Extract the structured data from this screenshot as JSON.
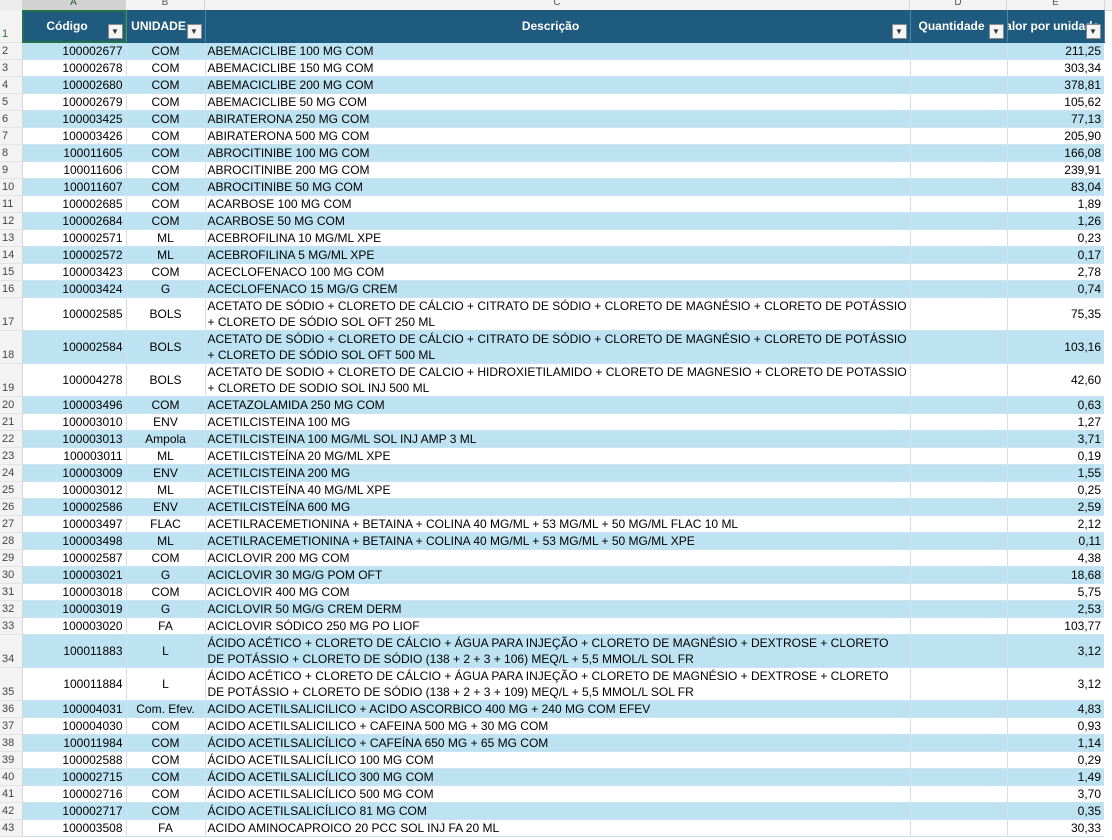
{
  "columns": [
    "A",
    "B",
    "C",
    "D",
    "E"
  ],
  "headers": {
    "codigo": "Código",
    "unidade": "UNIDADE",
    "descricao": "Descrição",
    "quantidade": "Quantidade",
    "valor": "Valor por unidade"
  },
  "rows": [
    {
      "n": "2",
      "codigo": "100002677",
      "unidade": "COM",
      "descricao": "ABEMACICLIBE 100 MG COM",
      "valor": "211,25"
    },
    {
      "n": "3",
      "codigo": "100002678",
      "unidade": "COM",
      "descricao": "ABEMACICLIBE 150 MG COM",
      "valor": "303,34"
    },
    {
      "n": "4",
      "codigo": "100002680",
      "unidade": "COM",
      "descricao": "ABEMACICLIBE 200 MG COM",
      "valor": "378,81"
    },
    {
      "n": "5",
      "codigo": "100002679",
      "unidade": "COM",
      "descricao": "ABEMACICLIBE 50 MG COM",
      "valor": "105,62"
    },
    {
      "n": "6",
      "codigo": "100003425",
      "unidade": "COM",
      "descricao": "ABIRATERONA 250 MG COM",
      "valor": "77,13"
    },
    {
      "n": "7",
      "codigo": "100003426",
      "unidade": "COM",
      "descricao": "ABIRATERONA 500 MG COM",
      "valor": "205,90"
    },
    {
      "n": "8",
      "codigo": "100011605",
      "unidade": "COM",
      "descricao": "ABROCITINIBE 100 MG COM",
      "valor": "166,08"
    },
    {
      "n": "9",
      "codigo": "100011606",
      "unidade": "COM",
      "descricao": "ABROCITINIBE 200 MG COM",
      "valor": "239,91"
    },
    {
      "n": "10",
      "codigo": "100011607",
      "unidade": "COM",
      "descricao": "ABROCITINIBE 50 MG COM",
      "valor": "83,04"
    },
    {
      "n": "11",
      "codigo": "100002685",
      "unidade": "COM",
      "descricao": "ACARBOSE 100 MG COM",
      "valor": "1,89"
    },
    {
      "n": "12",
      "codigo": "100002684",
      "unidade": "COM",
      "descricao": "ACARBOSE 50 MG COM",
      "valor": "1,26"
    },
    {
      "n": "13",
      "codigo": "100002571",
      "unidade": "ML",
      "descricao": "ACEBROFILINA 10 MG/ML XPE",
      "valor": "0,23"
    },
    {
      "n": "14",
      "codigo": "100002572",
      "unidade": "ML",
      "descricao": "ACEBROFILINA 5 MG/ML XPE",
      "valor": "0,17"
    },
    {
      "n": "15",
      "codigo": "100003423",
      "unidade": "COM",
      "descricao": "ACECLOFENACO 100 MG COM",
      "valor": "2,78"
    },
    {
      "n": "16",
      "codigo": "100003424",
      "unidade": "G",
      "descricao": "ACECLOFENACO 15 MG/G CREM",
      "valor": "0,74"
    },
    {
      "n": "17",
      "codigo": "100002585",
      "unidade": "BOLS",
      "descricao": "ACETATO DE SÓDIO + CLORETO DE CÁLCIO + CITRATO DE SÓDIO + CLORETO DE MAGNÉSIO + CLORETO DE POTÁSSIO + CLORETO DE SÓDIO SOL OFT 250 ML",
      "valor": "75,35",
      "tall": true
    },
    {
      "n": "18",
      "codigo": "100002584",
      "unidade": "BOLS",
      "descricao": "ACETATO DE SÓDIO + CLORETO DE CÁLCIO + CITRATO DE SÓDIO + CLORETO DE MAGNÉSIO + CLORETO DE POTÁSSIO + CLORETO DE SÓDIO SOL OFT 500 ML",
      "valor": "103,16",
      "tall": true
    },
    {
      "n": "19",
      "codigo": "100004278",
      "unidade": "BOLS",
      "descricao": "ACETATO DE SODIO + CLORETO DE CALCIO + HIDROXIETILAMIDO + CLORETO DE MAGNESIO + CLORETO DE POTASSIO + CLORETO DE SODIO SOL INJ 500 ML",
      "valor": "42,60",
      "tall": true
    },
    {
      "n": "20",
      "codigo": "100003496",
      "unidade": "COM",
      "descricao": "ACETAZOLAMIDA 250 MG COM",
      "valor": "0,63"
    },
    {
      "n": "21",
      "codigo": "100003010",
      "unidade": "ENV",
      "descricao": "ACETILCISTEINA 100 MG",
      "valor": "1,27"
    },
    {
      "n": "22",
      "codigo": "100003013",
      "unidade": "Ampola",
      "descricao": "ACETILCISTEINA 100 MG/ML SOL INJ AMP 3 ML",
      "valor": "3,71"
    },
    {
      "n": "23",
      "codigo": "100003011",
      "unidade": "ML",
      "descricao": "ACETILCISTEÍNA 20 MG/ML XPE",
      "valor": "0,19"
    },
    {
      "n": "24",
      "codigo": "100003009",
      "unidade": "ENV",
      "descricao": "ACETILCISTEINA 200 MG",
      "valor": "1,55"
    },
    {
      "n": "25",
      "codigo": "100003012",
      "unidade": "ML",
      "descricao": "ACETILCISTEÍNA 40 MG/ML XPE",
      "valor": "0,25"
    },
    {
      "n": "26",
      "codigo": "100002586",
      "unidade": "ENV",
      "descricao": "ACETILCISTEÍNA 600 MG",
      "valor": "2,59"
    },
    {
      "n": "27",
      "codigo": "100003497",
      "unidade": "FLAC",
      "descricao": "ACETILRACEMETIONINA + BETAINA + COLINA 40 MG/ML + 53 MG/ML + 50 MG/ML FLAC 10 ML",
      "valor": "2,12"
    },
    {
      "n": "28",
      "codigo": "100003498",
      "unidade": "ML",
      "descricao": "ACETILRACEMETIONINA + BETAINA + COLINA 40 MG/ML + 53 MG/ML + 50 MG/ML XPE",
      "valor": "0,11"
    },
    {
      "n": "29",
      "codigo": "100002587",
      "unidade": "COM",
      "descricao": "ACICLOVIR 200 MG COM",
      "valor": "4,38"
    },
    {
      "n": "30",
      "codigo": "100003021",
      "unidade": "G",
      "descricao": "ACICLOVIR 30 MG/G POM OFT",
      "valor": "18,68"
    },
    {
      "n": "31",
      "codigo": "100003018",
      "unidade": "COM",
      "descricao": "ACICLOVIR 400 MG COM",
      "valor": "5,75"
    },
    {
      "n": "32",
      "codigo": "100003019",
      "unidade": "G",
      "descricao": "ACICLOVIR 50 MG/G CREM DERM",
      "valor": "2,53"
    },
    {
      "n": "33",
      "codigo": "100003020",
      "unidade": "FA",
      "descricao": "ACICLOVIR SÓDICO 250 MG PO LIOF",
      "valor": "103,77"
    },
    {
      "n": "34",
      "codigo": "100011883",
      "unidade": "L",
      "descricao": "ÁCIDO ACÉTICO + CLORETO DE CÁLCIO + ÁGUA PARA INJEÇÃO + CLORETO DE MAGNÉSIO + DEXTROSE + CLORETO DE POTÁSSIO + CLORETO DE SÓDIO (138 + 2 + 3 + 106) MEQ/L + 5,5 MMOL/L SOL FR",
      "valor": "3,12",
      "tall": true
    },
    {
      "n": "35",
      "codigo": "100011884",
      "unidade": "L",
      "descricao": "ÁCIDO ACÉTICO + CLORETO DE CÁLCIO + ÁGUA PARA INJEÇÃO + CLORETO DE MAGNÉSIO + DEXTROSE + CLORETO DE POTÁSSIO + CLORETO DE SÓDIO (138 + 2 + 3 + 109) MEQ/L + 5,5 MMOL/L SOL FR",
      "valor": "3,12",
      "tall": true
    },
    {
      "n": "36",
      "codigo": "100004031",
      "unidade": "Com. Efev.",
      "descricao": "ACIDO ACETILSALICILICO + ACIDO ASCORBICO 400 MG + 240 MG COM EFEV",
      "valor": "4,83"
    },
    {
      "n": "37",
      "codigo": "100004030",
      "unidade": "COM",
      "descricao": "ACIDO ACETILSALICILICO + CAFEINA 500 MG + 30 MG COM",
      "valor": "0,93"
    },
    {
      "n": "38",
      "codigo": "100011984",
      "unidade": "COM",
      "descricao": "ÁCIDO ACETILSALICÍLICO + CAFEÍNA 650 MG + 65 MG COM",
      "valor": "1,14"
    },
    {
      "n": "39",
      "codigo": "100002588",
      "unidade": "COM",
      "descricao": "ÁCIDO ACETILSALICÍLICO 100 MG COM",
      "valor": "0,29"
    },
    {
      "n": "40",
      "codigo": "100002715",
      "unidade": "COM",
      "descricao": "ÁCIDO ACETILSALICÍLICO 300 MG COM",
      "valor": "1,49"
    },
    {
      "n": "41",
      "codigo": "100002716",
      "unidade": "COM",
      "descricao": "ÁCIDO ACETILSALICÍLICO 500 MG COM",
      "valor": "3,70"
    },
    {
      "n": "42",
      "codigo": "100002717",
      "unidade": "COM",
      "descricao": "ÁCIDO ACETILSALICÍLICO 81 MG COM",
      "valor": "0,35"
    },
    {
      "n": "43",
      "codigo": "100003508",
      "unidade": "FA",
      "descricao": "ACIDO AMINOCAPROICO 20 PCC SOL INJ FA 20 ML",
      "valor": "30,33"
    }
  ],
  "header_row_number": "1",
  "filter_icon": "dropdown-arrow-icon",
  "colors": {
    "header_bg": "#1f5b7e",
    "alt_row": "#bde3f2",
    "selection": "#217346"
  }
}
